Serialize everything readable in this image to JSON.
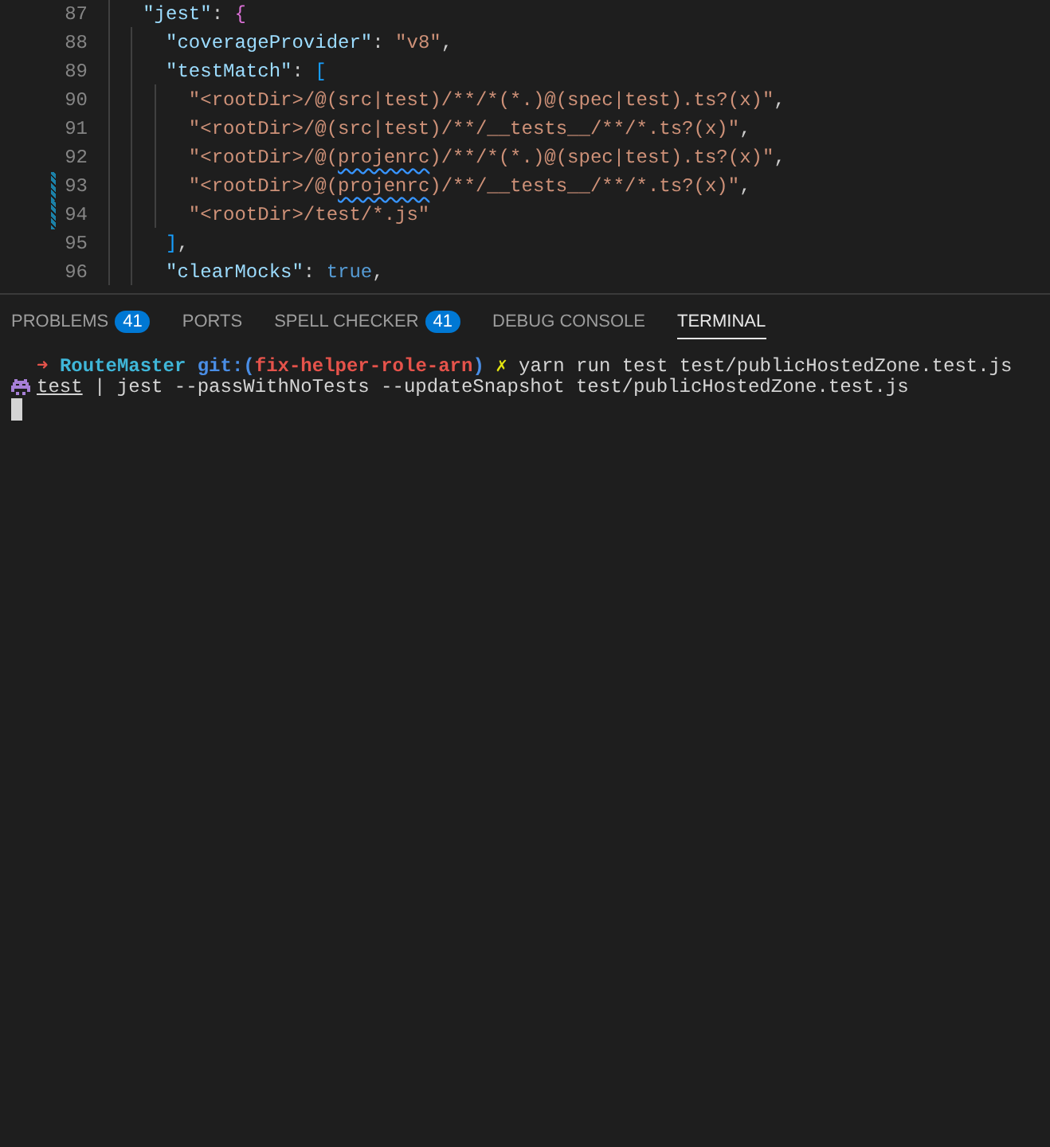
{
  "editor": {
    "lines": [
      {
        "number": "87",
        "modified": false,
        "tokens": [
          {
            "kind": "key",
            "text": "  \"jest\""
          },
          {
            "kind": "punct",
            "text": ": "
          },
          {
            "kind": "brace",
            "text": "{"
          }
        ]
      },
      {
        "number": "88",
        "modified": false,
        "tokens": [
          {
            "kind": "key",
            "text": "    \"coverageProvider\""
          },
          {
            "kind": "punct",
            "text": ": "
          },
          {
            "kind": "string",
            "text": "\"v8\""
          },
          {
            "kind": "punct",
            "text": ","
          }
        ]
      },
      {
        "number": "89",
        "modified": false,
        "tokens": [
          {
            "kind": "key",
            "text": "    \"testMatch\""
          },
          {
            "kind": "punct",
            "text": ": "
          },
          {
            "kind": "bracket",
            "text": "["
          }
        ]
      },
      {
        "number": "90",
        "modified": false,
        "tokens": [
          {
            "kind": "string",
            "text": "      \"<rootDir>/@(src|test)/**/*(*.)@(spec|test).ts?(x)\""
          },
          {
            "kind": "punct",
            "text": ","
          }
        ]
      },
      {
        "number": "91",
        "modified": false,
        "tokens": [
          {
            "kind": "string",
            "text": "      \"<rootDir>/@(src|test)/**/__tests__/**/*.ts?(x)\""
          },
          {
            "kind": "punct",
            "text": ","
          }
        ]
      },
      {
        "number": "92",
        "modified": false,
        "tokens": [
          {
            "kind": "string",
            "text": "      \"<rootDir>/@("
          },
          {
            "kind": "misspelled",
            "text": "projenrc"
          },
          {
            "kind": "string",
            "text": ")/**/*(*.)@(spec|test).ts?(x)\""
          },
          {
            "kind": "punct",
            "text": ","
          }
        ]
      },
      {
        "number": "93",
        "modified": true,
        "tokens": [
          {
            "kind": "string",
            "text": "      \"<rootDir>/@("
          },
          {
            "kind": "misspelled",
            "text": "projenrc"
          },
          {
            "kind": "string",
            "text": ")/**/__tests__/**/*.ts?(x)\""
          },
          {
            "kind": "punct",
            "text": ","
          }
        ]
      },
      {
        "number": "94",
        "modified": true,
        "tokens": [
          {
            "kind": "string",
            "text": "      \"<rootDir>/test/*.js\""
          }
        ]
      },
      {
        "number": "95",
        "modified": false,
        "tokens": [
          {
            "kind": "bracket",
            "text": "    ]"
          },
          {
            "kind": "punct",
            "text": ","
          }
        ]
      },
      {
        "number": "96",
        "modified": false,
        "tokens": [
          {
            "kind": "key",
            "text": "    \"clearMocks\""
          },
          {
            "kind": "punct",
            "text": ": "
          },
          {
            "kind": "literal",
            "text": "true"
          },
          {
            "kind": "punct",
            "text": ","
          }
        ]
      }
    ]
  },
  "panel": {
    "tabs": [
      {
        "label": "PROBLEMS",
        "badge": "41",
        "selected": false
      },
      {
        "label": "PORTS",
        "selected": false
      },
      {
        "label": "SPELL CHECKER",
        "badge": "41",
        "selected": false
      },
      {
        "label": "DEBUG CONSOLE",
        "selected": false
      },
      {
        "label": "TERMINAL",
        "selected": true
      }
    ],
    "terminal": {
      "lines": [
        {
          "kind": "prompt",
          "tokens": [
            {
              "kind": "arrow",
              "text": "➜"
            },
            {
              "kind": "dir",
              "text": "RouteMaster"
            },
            {
              "kind": "git",
              "text": "git:("
            },
            {
              "kind": "branch",
              "text": "fix-helper-role-arn"
            },
            {
              "kind": "git",
              "text": ")"
            },
            {
              "kind": "dirty",
              "text": "✗"
            },
            {
              "kind": "plain",
              "text": "yarn run test test/publicHostedZone.test.js"
            }
          ]
        },
        {
          "kind": "output",
          "tokens": [
            {
              "kind": "underlined",
              "text": "test"
            },
            {
              "kind": "plain",
              "text": "| jest --passWithNoTests --updateSnapshot test/publicHostedZone.test.js"
            }
          ]
        }
      ],
      "cursor": true
    }
  }
}
